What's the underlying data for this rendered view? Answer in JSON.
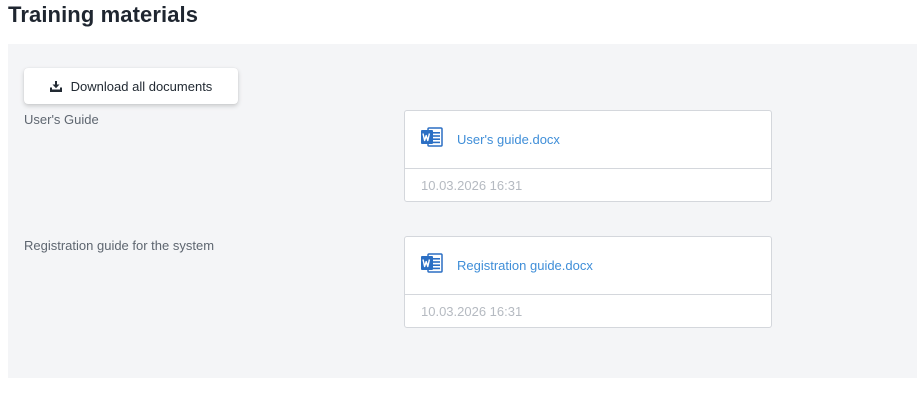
{
  "page": {
    "title": "Training materials"
  },
  "toolbar": {
    "download_all_label": "Download all documents",
    "download_icon": "download-icon"
  },
  "materials": [
    {
      "label": "User's Guide",
      "file": {
        "icon": "word-document-icon",
        "name": "User's guide.docx",
        "date": "10.03.2026 16:31"
      }
    },
    {
      "label": "Registration guide for the system",
      "file": {
        "icon": "word-document-icon",
        "name": "Registration guide.docx",
        "date": "10.03.2026 16:31"
      }
    }
  ],
  "colors": {
    "panel_background": "#f4f5f7",
    "link": "#3f8ed8",
    "word_blue": "#2b6fc4",
    "muted_text": "#b5bac1"
  }
}
